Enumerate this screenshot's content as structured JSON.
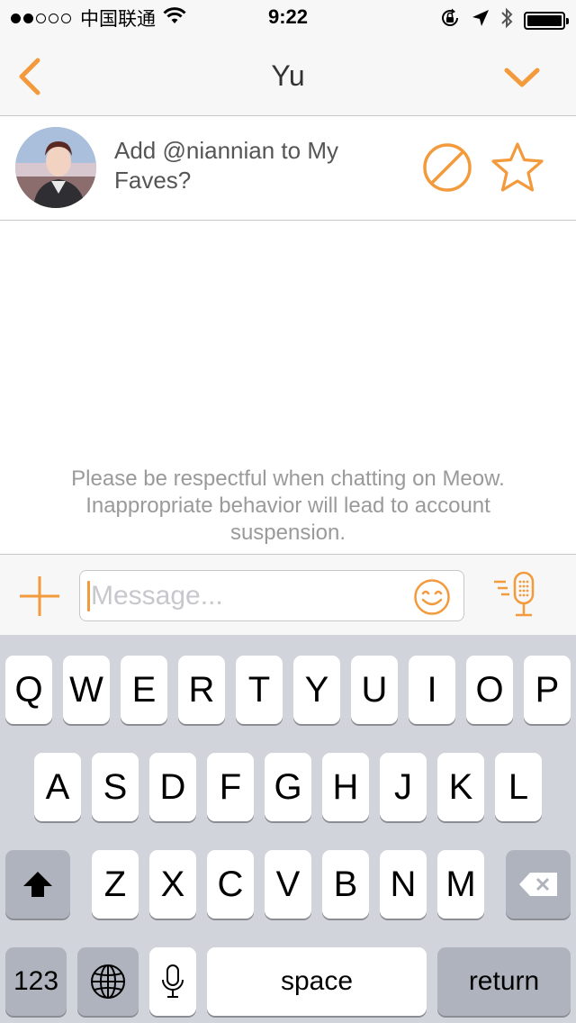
{
  "status_bar": {
    "carrier": "中国联通",
    "time": "9:22"
  },
  "nav": {
    "title": "Yu"
  },
  "fave_prompt": {
    "text": "Add @niannian to My Faves?"
  },
  "chat": {
    "notice": "Please be respectful when chatting on Meow. Inappropriate behavior will lead to account suspension."
  },
  "input": {
    "placeholder": "Message..."
  },
  "keyboard": {
    "row1": [
      "Q",
      "W",
      "E",
      "R",
      "T",
      "Y",
      "U",
      "I",
      "O",
      "P"
    ],
    "row2": [
      "A",
      "S",
      "D",
      "F",
      "G",
      "H",
      "J",
      "K",
      "L"
    ],
    "row3": [
      "Z",
      "X",
      "C",
      "V",
      "B",
      "N",
      "M"
    ],
    "numbers_label": "123",
    "space_label": "space",
    "return_label": "return"
  },
  "colors": {
    "accent": "#f39a3c",
    "nav_background": "#f7f7f7",
    "keyboard_background": "#d1d5db"
  },
  "icons": [
    "back-chevron-icon",
    "chevron-down-icon",
    "block-icon",
    "star-icon",
    "plus-icon",
    "emoji-icon",
    "voice-mic-icon",
    "wifi-icon",
    "lock-rotation-icon",
    "location-arrow-icon",
    "bluetooth-icon",
    "battery-icon",
    "shift-icon",
    "delete-icon",
    "globe-icon",
    "dictation-mic-icon"
  ]
}
